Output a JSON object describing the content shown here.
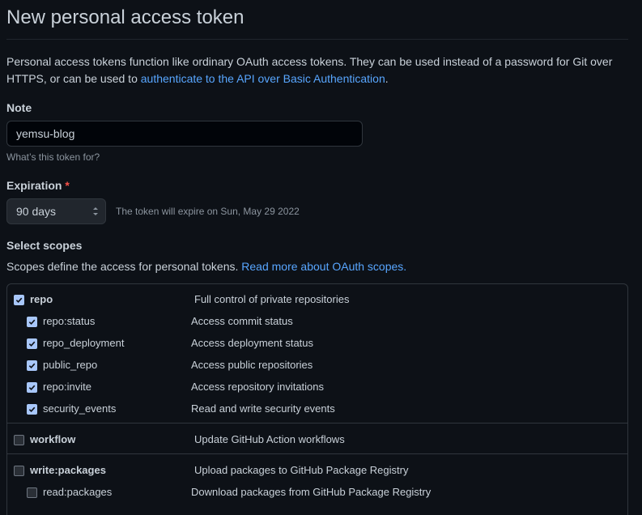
{
  "header": {
    "title": "New personal access token"
  },
  "intro": {
    "text_before": "Personal access tokens function like ordinary OAuth access tokens. They can be used instead of a password for Git over HTTPS, or can be used to ",
    "link_text": "authenticate to the API over Basic Authentication",
    "text_after": "."
  },
  "note": {
    "label": "Note",
    "value": "yemsu-blog",
    "hint": "What’s this token for?"
  },
  "expiration": {
    "label": "Expiration",
    "required_marker": "*",
    "selected": "90 days",
    "message": "The token will expire on Sun, May 29 2022"
  },
  "scopes": {
    "heading": "Select scopes",
    "description": "Scopes define the access for personal tokens. ",
    "link_text": "Read more about OAuth scopes.",
    "groups": [
      {
        "name": "repo",
        "description": "Full control of private repositories",
        "checked": true,
        "children": [
          {
            "name": "repo:status",
            "description": "Access commit status",
            "checked": true
          },
          {
            "name": "repo_deployment",
            "description": "Access deployment status",
            "checked": true
          },
          {
            "name": "public_repo",
            "description": "Access public repositories",
            "checked": true
          },
          {
            "name": "repo:invite",
            "description": "Access repository invitations",
            "checked": true
          },
          {
            "name": "security_events",
            "description": "Read and write security events",
            "checked": true
          }
        ]
      },
      {
        "name": "workflow",
        "description": "Update GitHub Action workflows",
        "checked": false,
        "children": []
      },
      {
        "name": "write:packages",
        "description": "Upload packages to GitHub Package Registry",
        "checked": false,
        "children": [
          {
            "name": "read:packages",
            "description": "Download packages from GitHub Package Registry",
            "checked": false
          }
        ]
      }
    ]
  },
  "colors": {
    "background": "#0d1117",
    "link": "#58a6ff",
    "checkbox_checked": "#a8c7fa",
    "required": "#f85149"
  }
}
